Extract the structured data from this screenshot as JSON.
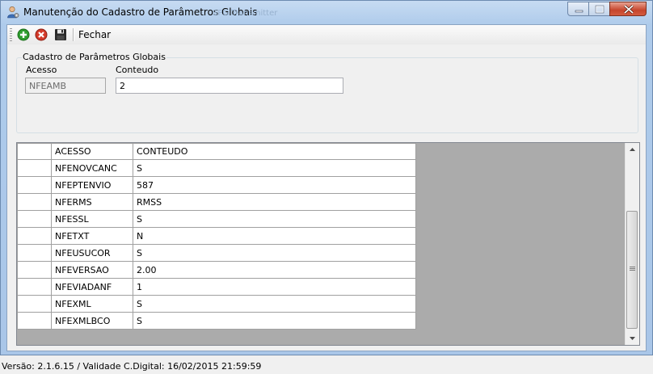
{
  "window": {
    "title": "Manutenção do Cadastro de Parâmetros Globais",
    "ghost_title": "SPG Transmitter",
    "icons": {
      "app": "user-gear-icon",
      "minimize": "minimize-icon",
      "maximize": "maximize-icon",
      "close": "close-icon"
    }
  },
  "toolbar": {
    "close_label": "Fechar",
    "icons": [
      "add-icon",
      "delete-icon",
      "save-icon"
    ]
  },
  "form": {
    "group_title": "Cadastro de Parâmetros Globais",
    "acesso_label": "Acesso",
    "acesso_value": "NFEAMB",
    "conteudo_label": "Conteudo",
    "conteudo_value": "2"
  },
  "grid": {
    "columns": [
      "ACESSO",
      "CONTEUDO"
    ],
    "rows": [
      [
        "NFENOVCANC",
        "S"
      ],
      [
        "NFEPTENVIO",
        "587"
      ],
      [
        "NFERMS",
        "RMSS"
      ],
      [
        "NFESSL",
        "S"
      ],
      [
        "NFETXT",
        "N"
      ],
      [
        "NFEUSUCOR",
        "S"
      ],
      [
        "NFEVERSAO",
        "2.00"
      ],
      [
        "NFEVIADANF",
        "1"
      ],
      [
        "NFEXML",
        "S"
      ],
      [
        "NFEXMLBCO",
        "S"
      ]
    ]
  },
  "status": {
    "text": "Versão: 2.1.6.15 / Validade C.Digital: 16/02/2015 21:59:59"
  },
  "colors": {
    "accent_green": "#2e9d2e",
    "accent_red": "#d43a2a",
    "grid_background": "#ababab"
  }
}
